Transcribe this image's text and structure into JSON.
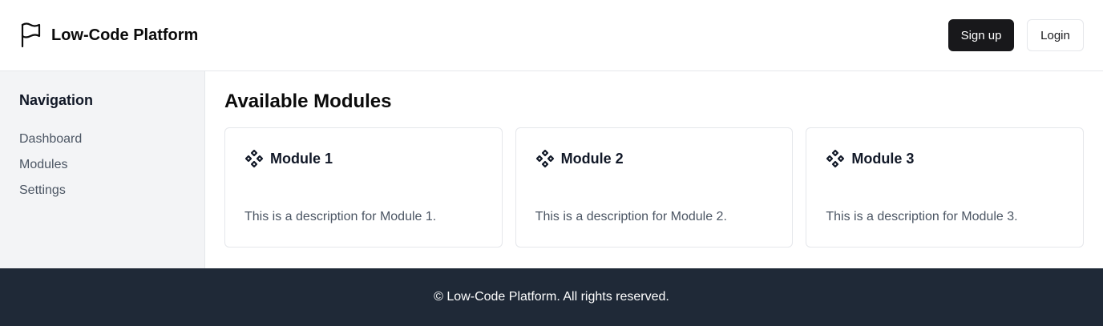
{
  "header": {
    "title": "Low-Code Platform",
    "signup_label": "Sign up",
    "login_label": "Login",
    "logo_icon": "flag-icon"
  },
  "sidebar": {
    "title": "Navigation",
    "items": [
      {
        "label": "Dashboard"
      },
      {
        "label": "Modules"
      },
      {
        "label": "Settings"
      }
    ]
  },
  "main": {
    "title": "Available Modules",
    "modules": [
      {
        "title": "Module 1",
        "description": "This is a description for Module 1.",
        "icon": "module-icon"
      },
      {
        "title": "Module 2",
        "description": "This is a description for Module 2.",
        "icon": "module-icon"
      },
      {
        "title": "Module 3",
        "description": "This is a description for Module 3.",
        "icon": "module-icon"
      }
    ]
  },
  "footer": {
    "text": "© Low-Code Platform. All rights reserved."
  },
  "colors": {
    "primary_button": "#18181b",
    "sidebar_bg": "#f3f4f6",
    "footer_bg": "#1f2937",
    "muted_text": "#4b5563"
  }
}
